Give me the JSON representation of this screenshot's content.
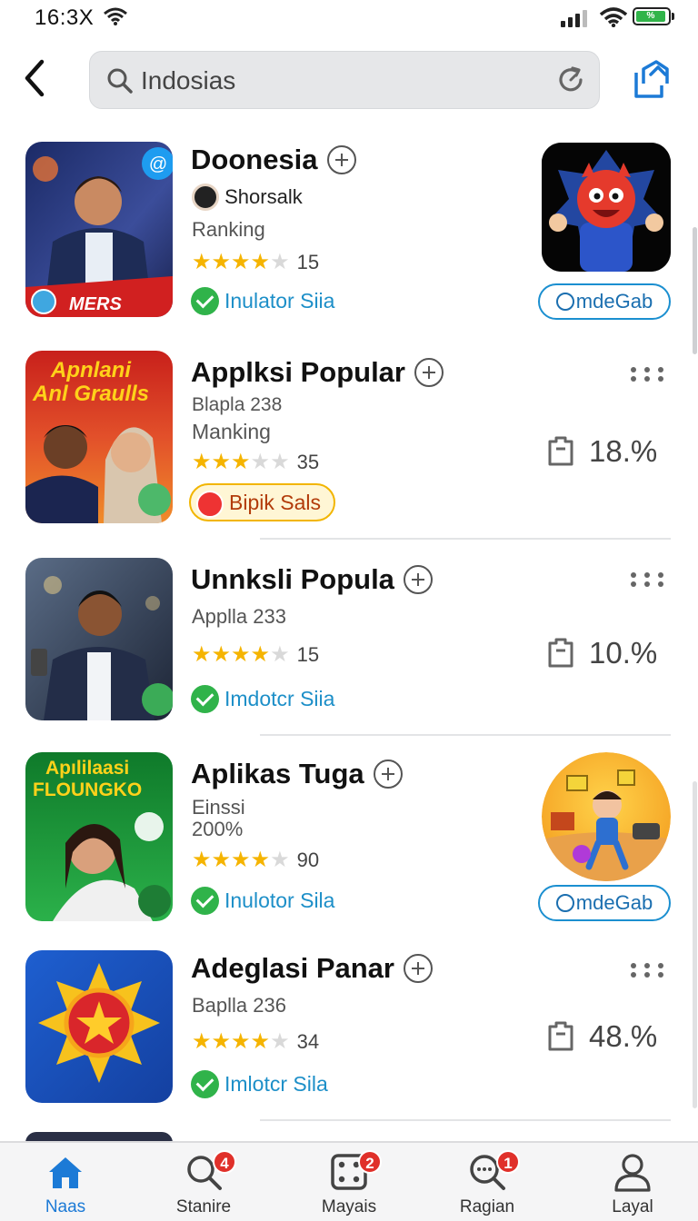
{
  "status": {
    "time": "16:3X",
    "battery_label": "%"
  },
  "search": {
    "value": "Indosias",
    "placeholder": "Indosias"
  },
  "apps": [
    {
      "title": "Doonesia",
      "developer": "Shorsalk",
      "line": "Ranking",
      "rating": 3.5,
      "rating_count": "15",
      "badge_label": "Inulator Siia",
      "thumb_text": "MERS",
      "action_label": "mdeGab"
    },
    {
      "title": "Applksi Popular",
      "line1": "Blapla 238",
      "line2": "Manking",
      "rating": 2.5,
      "rating_count": "35",
      "pill_label": "Bipik Sals",
      "thumb_text_1": "Apnlani",
      "thumb_text_2": "Anl Graulls",
      "percent": "18.%"
    },
    {
      "title": "Unnksli Popula",
      "line1": "Applla 233",
      "rating": 3.5,
      "rating_count": "15",
      "badge_label": "Imdotcr Siia",
      "percent": "10.%"
    },
    {
      "title": "Aplikas Tuga",
      "line1": "Einssi",
      "line2": "200%",
      "rating": 3.5,
      "rating_count": "90",
      "badge_label": "Inulotor Sila",
      "thumb_text_1": "Apılilaasi",
      "thumb_text_2": "FLOUNGKO",
      "action_label": "mdeGab"
    },
    {
      "title": "Adeglasi Panar",
      "line1": "Baplla 236",
      "rating": 3.5,
      "rating_count": "34",
      "badge_label": "Imlotcr Sila",
      "percent": "48.%"
    }
  ],
  "nav": [
    {
      "label": "Naas",
      "badge": ""
    },
    {
      "label": "Stanire",
      "badge": "4"
    },
    {
      "label": "Mayais",
      "badge": "2"
    },
    {
      "label": "Ragian",
      "badge": "1"
    },
    {
      "label": "Layal",
      "badge": ""
    }
  ],
  "colors": {
    "accent": "#1c7ad6",
    "star": "#f5b400",
    "verified": "#30b34a",
    "badge": "#e0302a"
  }
}
